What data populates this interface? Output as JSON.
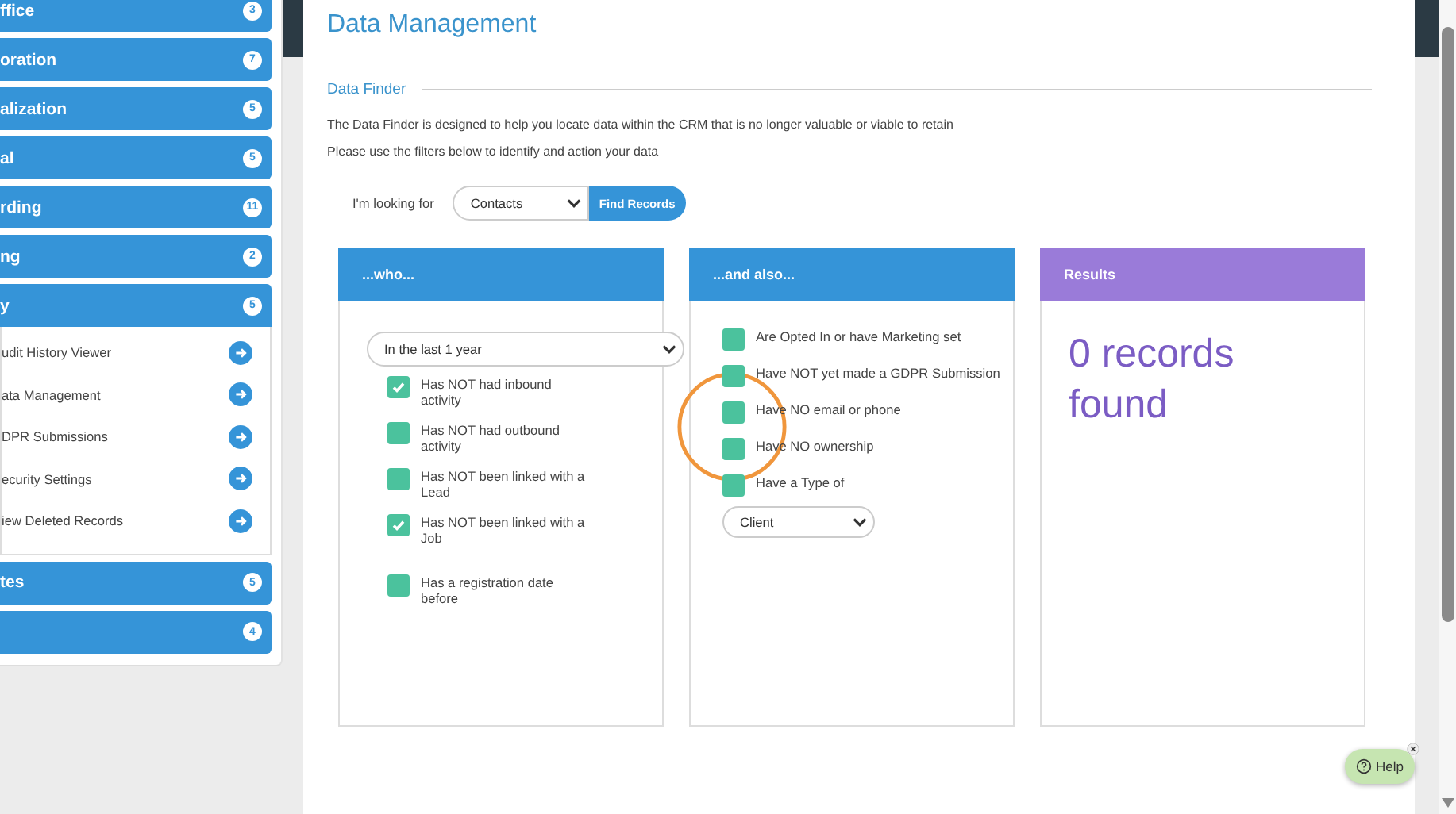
{
  "sidebar": {
    "groups": [
      {
        "label": "ffice",
        "count": "3",
        "expanded": false
      },
      {
        "label": "oration",
        "count": "7",
        "expanded": false
      },
      {
        "label": "alization",
        "count": "5",
        "expanded": false
      },
      {
        "label": "al",
        "count": "5",
        "expanded": false
      },
      {
        "label": "rding",
        "count": "11",
        "expanded": false
      },
      {
        "label": "ng",
        "count": "2",
        "expanded": false
      },
      {
        "label": "y",
        "count": "5",
        "expanded": true,
        "items": [
          "udit History Viewer",
          "ata Management",
          "DPR Submissions",
          "ecurity Settings",
          "iew Deleted Records"
        ]
      },
      {
        "label": "tes",
        "count": "5",
        "expanded": false
      },
      {
        "count": "4",
        "expanded": false
      }
    ]
  },
  "page": {
    "title": "Data Management",
    "section": "Data Finder",
    "intro": [
      "The Data Finder is designed to help you locate data within the CRM that is no longer valuable or viable to retain",
      "Please use the filters below to identify and action your data"
    ],
    "looking_for": {
      "label": "I'm looking for",
      "value": "Contacts",
      "button": "Find Records"
    }
  },
  "who": {
    "title": "...who...",
    "period": "In the last 1 year",
    "filters": [
      {
        "label": "Has NOT had inbound activity",
        "checked": true
      },
      {
        "label": "Has NOT had outbound activity",
        "checked": false
      },
      {
        "label": "Has NOT been linked with a Lead",
        "checked": false
      },
      {
        "label": "Has NOT been linked with a Job",
        "checked": true
      },
      {
        "label": "Has a registration date before",
        "checked": false
      }
    ]
  },
  "also": {
    "title": "...and also...",
    "filters": [
      {
        "label": "Are Opted In or have Marketing set",
        "checked": false
      },
      {
        "label": "Have NOT yet made a GDPR Submission",
        "checked": false
      },
      {
        "label": "Have NO email or phone",
        "checked": false
      },
      {
        "label": "Have NO ownership",
        "checked": false
      },
      {
        "label": "Have a Type of",
        "checked": false
      }
    ],
    "type_value": "Client"
  },
  "results": {
    "title": "Results",
    "text": "0 records found"
  },
  "help": {
    "label": "Help"
  }
}
